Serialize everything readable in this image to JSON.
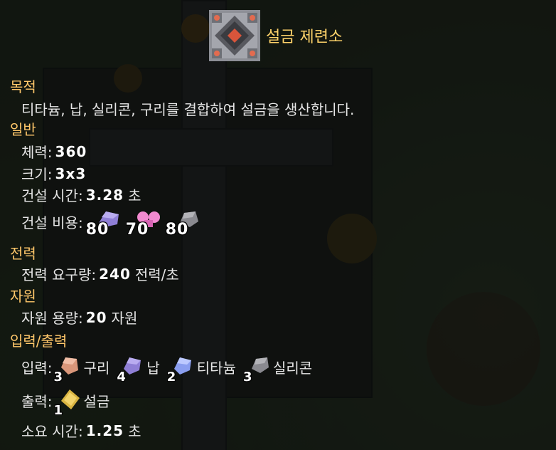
{
  "building": {
    "title": "설금 제련소",
    "icon": "smelter-icon"
  },
  "purpose": {
    "heading": "목적",
    "text": "티타늄, 납, 실리콘, 구리를 결합하여 설금을 생산합니다."
  },
  "general": {
    "heading": "일반",
    "health_label": "체력:",
    "health_value": "360",
    "size_label": "크기:",
    "size_value": "3x3",
    "build_time_label": "건설 시간:",
    "build_time_value": "3.28",
    "build_time_unit": "초",
    "build_cost_label": "건설 비용:",
    "build_cost": [
      {
        "amount": "80",
        "icon": "lead-icon",
        "color": "#8f7fd6"
      },
      {
        "amount": "70",
        "icon": "pink-item-icon",
        "color": "#f28ad0"
      },
      {
        "amount": "80",
        "icon": "silicon-icon",
        "color": "#8a8a90"
      }
    ]
  },
  "power": {
    "heading": "전력",
    "usage_label": "전력 요구량:",
    "usage_value": "240",
    "usage_unit": "전력/초"
  },
  "items": {
    "heading": "자원",
    "capacity_label": "자원 용량:",
    "capacity_value": "20",
    "capacity_unit": "자원"
  },
  "io": {
    "heading": "입력/출력",
    "input_label": "입력:",
    "inputs": [
      {
        "count": "3",
        "name": "구리",
        "icon": "copper-icon",
        "color": "#d9967a"
      },
      {
        "count": "4",
        "name": "납",
        "icon": "lead-icon",
        "color": "#8f7fd6"
      },
      {
        "count": "2",
        "name": "티타늄",
        "icon": "titanium-icon",
        "color": "#8a9ef0"
      },
      {
        "count": "3",
        "name": "실리콘",
        "icon": "silicon-icon",
        "color": "#8a8a90"
      }
    ],
    "output_label": "출력:",
    "outputs": [
      {
        "count": "1",
        "name": "설금",
        "icon": "surge-alloy-icon",
        "color": "#f2d36b"
      }
    ],
    "time_label": "소요 시간:",
    "time_value": "1.25",
    "time_unit": "초"
  }
}
